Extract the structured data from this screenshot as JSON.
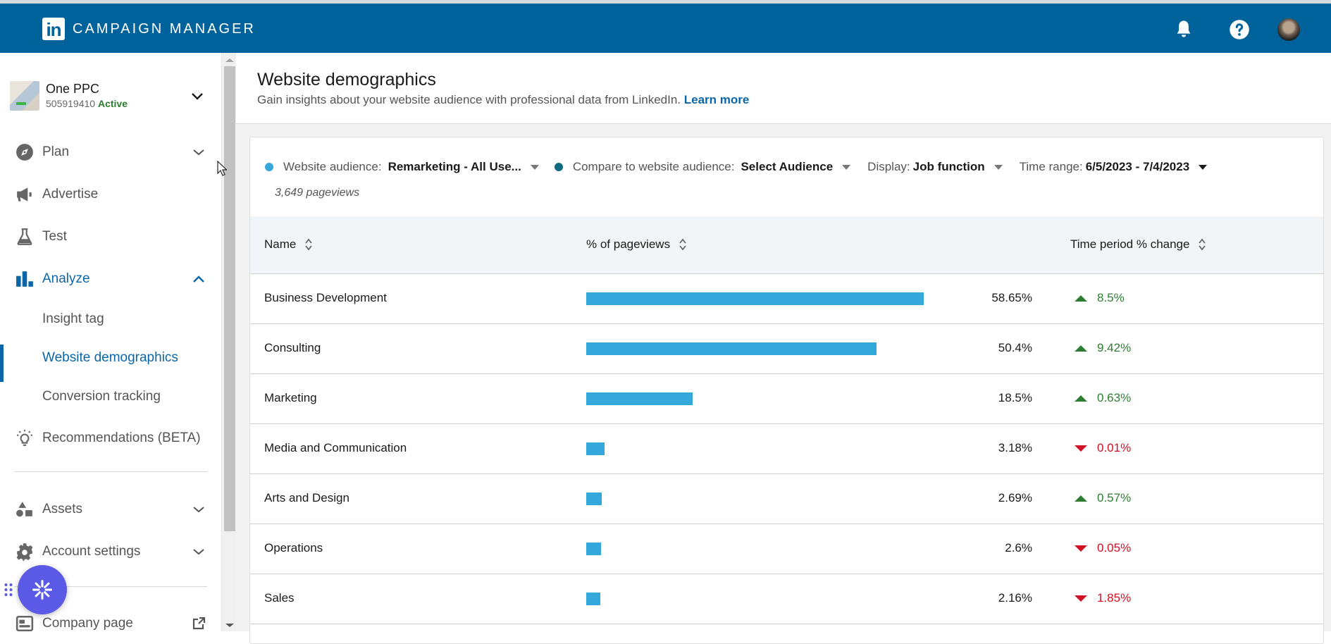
{
  "header": {
    "logo_text": "in",
    "app_title": "CAMPAIGN MANAGER",
    "icons": [
      "bell-icon",
      "help-icon",
      "avatar"
    ]
  },
  "account": {
    "name": "One PPC",
    "id": "505919410",
    "status": "Active"
  },
  "sidebar": {
    "items": [
      {
        "label": "Plan",
        "icon": "compass-icon",
        "expandable": true,
        "expanded": false
      },
      {
        "label": "Advertise",
        "icon": "megaphone-icon",
        "expandable": false
      },
      {
        "label": "Test",
        "icon": "flask-icon",
        "expandable": false
      },
      {
        "label": "Analyze",
        "icon": "bar-chart-icon",
        "expandable": true,
        "expanded": true
      },
      {
        "label": "Recommendations (BETA)",
        "icon": "lightbulb-icon",
        "expandable": false
      },
      {
        "label": "Assets",
        "icon": "shapes-icon",
        "expandable": true,
        "expanded": false
      },
      {
        "label": "Account settings",
        "icon": "gear-icon",
        "expandable": true,
        "expanded": false
      },
      {
        "label": "Company page",
        "icon": "company-page-icon",
        "external": true
      }
    ],
    "analyze_subitems": [
      {
        "label": "Insight tag",
        "selected": false
      },
      {
        "label": "Website demographics",
        "selected": true
      },
      {
        "label": "Conversion tracking",
        "selected": false
      }
    ]
  },
  "page": {
    "title": "Website demographics",
    "subtitle": "Gain insights about your website audience with professional data from LinkedIn.",
    "learn_more": "Learn more"
  },
  "filters": {
    "audience_label": "Website audience:",
    "audience_value": "Remarketing - All Use...",
    "audience_color": "#34a8db",
    "compare_label": "Compare to website audience:",
    "compare_value": "Select Audience",
    "compare_color": "#0e6b80",
    "display_label": "Display:",
    "display_value": "Job function",
    "time_label": "Time range:",
    "time_value": "6/5/2023 - 7/4/2023",
    "pageviews": "3,649 pageviews"
  },
  "table": {
    "columns": [
      "Name",
      "% of pageviews",
      "Time period % change"
    ],
    "rows": [
      {
        "name": "Business Development",
        "pct": 58.65,
        "pct_label": "58.65%",
        "change": "8.5%",
        "direction": "up"
      },
      {
        "name": "Consulting",
        "pct": 50.4,
        "pct_label": "50.4%",
        "change": "9.42%",
        "direction": "up"
      },
      {
        "name": "Marketing",
        "pct": 18.5,
        "pct_label": "18.5%",
        "change": "0.63%",
        "direction": "up"
      },
      {
        "name": "Media and Communication",
        "pct": 3.18,
        "pct_label": "3.18%",
        "change": "0.01%",
        "direction": "down"
      },
      {
        "name": "Arts and Design",
        "pct": 2.69,
        "pct_label": "2.69%",
        "change": "0.57%",
        "direction": "up"
      },
      {
        "name": "Operations",
        "pct": 2.6,
        "pct_label": "2.6%",
        "change": "0.05%",
        "direction": "down"
      },
      {
        "name": "Sales",
        "pct": 2.16,
        "pct_label": "2.16%",
        "change": "1.85%",
        "direction": "down"
      }
    ]
  },
  "colors": {
    "brand": "#00629b",
    "accent": "#0a66a8",
    "bar": "#34a8db",
    "positive": "#2e7d32",
    "negative": "#d11124",
    "fab": "#5a5ae6"
  }
}
